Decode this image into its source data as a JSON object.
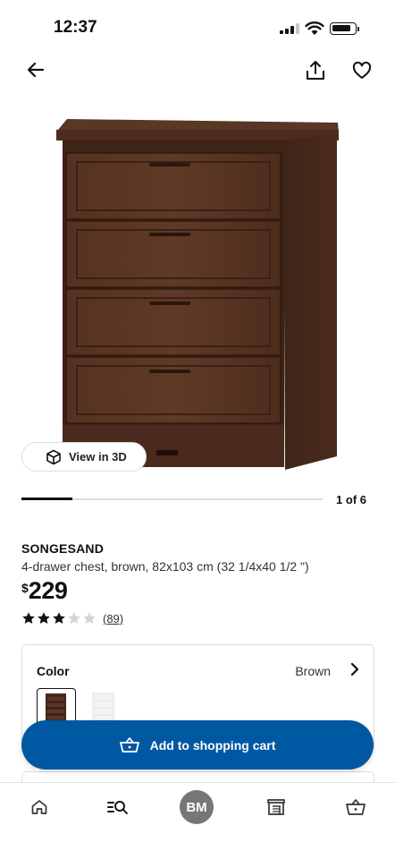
{
  "status_bar": {
    "time": "12:37"
  },
  "icons": {
    "back": "arrow-left",
    "share": "share",
    "favourite": "heart",
    "view3d": "cube",
    "chevron": "chevron-right",
    "cart": "basket",
    "home": "home",
    "search": "search",
    "stores": "store",
    "tab_cart": "basket"
  },
  "gallery": {
    "view_in_3d_label": "View in 3D",
    "page_indicator": "1 of 6",
    "progress": 0.17
  },
  "product": {
    "name": "SONGESAND",
    "description": "4-drawer chest, brown, 82x103 cm (32 1/4x40 1/2 \")",
    "currency": "$",
    "price": "229",
    "rating": 3,
    "rating_max": 5,
    "review_count": "(89)"
  },
  "color_selector": {
    "label": "Color",
    "selected_value": "Brown",
    "options": [
      "Brown",
      "White"
    ]
  },
  "cart_button": {
    "label": "Add to shopping cart"
  },
  "tab_bar": {
    "profile_initials": "BM"
  },
  "colors": {
    "brand_blue": "#0058a3",
    "wood_brown": "#4a2a1e",
    "star_filled": "#111111",
    "star_empty": "#d4d4d4",
    "avatar_grey": "#767676"
  }
}
